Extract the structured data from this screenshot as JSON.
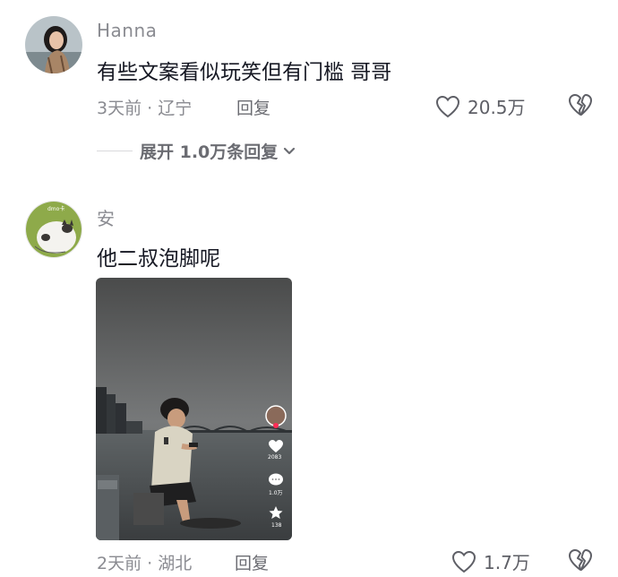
{
  "comments": [
    {
      "username": "Hanna",
      "text": "有些文案看似玩笑但有门槛 哥哥",
      "meta": "3天前 · 辽宁",
      "reply_label": "回复",
      "likes": "20.5万",
      "expand_label": "展开 1.0万条回复"
    },
    {
      "username": "安",
      "text": "他二叔泡脚呢",
      "avatar_text": "dmo卡",
      "meta": "2天前 · 湖北",
      "reply_label": "回复",
      "likes": "1.7万",
      "video": {
        "like_count": "2083",
        "comment_count": "1.0万",
        "fav_count": "138"
      }
    }
  ],
  "colors": {
    "text_primary": "#161823",
    "text_secondary": "#8a8b91",
    "icon": "#5e5f66"
  }
}
